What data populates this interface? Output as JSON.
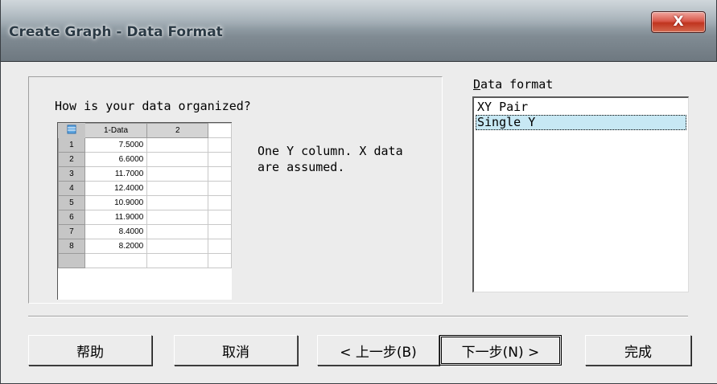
{
  "window": {
    "title": "Create Graph - Data Format",
    "close_label": "X"
  },
  "preview": {
    "question": "How is your data organized?",
    "columns": [
      "1-Data",
      "2"
    ],
    "rows": [
      {
        "num": "1",
        "value": "7.5000"
      },
      {
        "num": "2",
        "value": "6.6000"
      },
      {
        "num": "3",
        "value": "11.7000"
      },
      {
        "num": "4",
        "value": "12.4000"
      },
      {
        "num": "5",
        "value": "10.9000"
      },
      {
        "num": "6",
        "value": "11.9000"
      },
      {
        "num": "7",
        "value": "8.4000"
      },
      {
        "num": "8",
        "value": "8.2000"
      }
    ],
    "description": "One Y column.  X data are assumed."
  },
  "format": {
    "label_prefix": "D",
    "label_rest": "ata format",
    "items": [
      "XY Pair",
      "Single Y"
    ],
    "selected": "Single Y"
  },
  "buttons": {
    "help": "帮助",
    "cancel": "取消",
    "back": "< 上一步(B)",
    "next": "下一步(N) >",
    "finish": "完成"
  }
}
